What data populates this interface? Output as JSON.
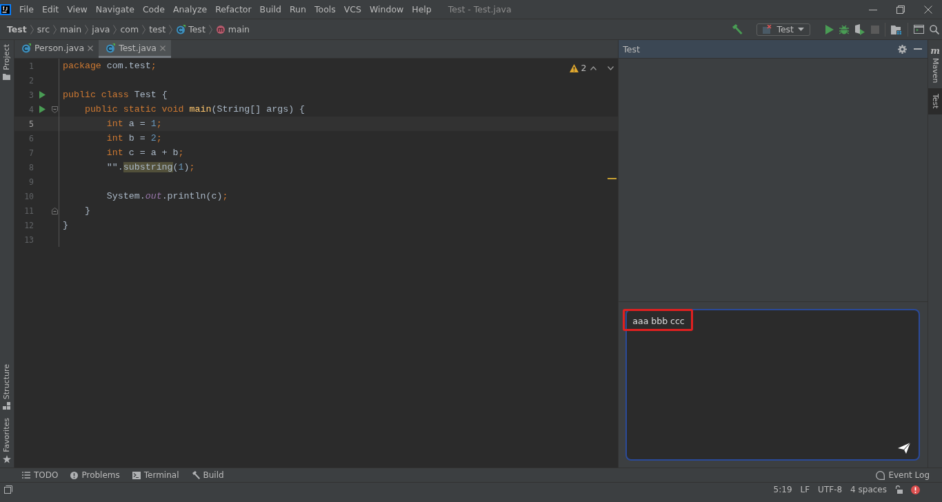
{
  "window": {
    "title": "Test - Test.java"
  },
  "menu": [
    "File",
    "Edit",
    "View",
    "Navigate",
    "Code",
    "Analyze",
    "Refactor",
    "Build",
    "Run",
    "Tools",
    "VCS",
    "Window",
    "Help"
  ],
  "breadcrumbs": [
    {
      "label": "Test",
      "kind": "project"
    },
    {
      "label": "src",
      "kind": "folder"
    },
    {
      "label": "main",
      "kind": "folder"
    },
    {
      "label": "java",
      "kind": "folder"
    },
    {
      "label": "com",
      "kind": "folder"
    },
    {
      "label": "test",
      "kind": "folder"
    },
    {
      "label": "Test",
      "kind": "class"
    },
    {
      "label": "main",
      "kind": "method"
    }
  ],
  "run_config": {
    "label": "Test"
  },
  "editor_tabs": [
    {
      "label": "Person.java",
      "selected": false
    },
    {
      "label": "Test.java",
      "selected": true
    }
  ],
  "left_stripes_top": [
    {
      "label": "Project",
      "kind": "project"
    }
  ],
  "left_stripes_bottom": [
    {
      "label": "Structure",
      "kind": "structure"
    },
    {
      "label": "Favorites",
      "kind": "favorites"
    }
  ],
  "right_stripes": [
    {
      "label": "Maven",
      "kind": "maven",
      "glyph": "m",
      "selected": false
    },
    {
      "label": "Test",
      "kind": "plain",
      "selected": true
    }
  ],
  "editor": {
    "warnings": "2",
    "lines": [
      {
        "number": "1",
        "current": false,
        "run": false,
        "fold_start": false,
        "fold_end": false,
        "tokens": [
          {
            "text": "package",
            "kind": "keyword"
          },
          {
            "text": " com.test",
            "kind": "plain"
          },
          {
            "text": ";",
            "kind": "punct"
          }
        ]
      },
      {
        "number": "2",
        "current": false,
        "run": false,
        "fold_start": false,
        "fold_end": false
      },
      {
        "number": "3",
        "current": false,
        "run": true,
        "fold_start": false,
        "fold_end": false,
        "tokens": [
          {
            "text": "public class",
            "kind": "keyword"
          },
          {
            "text": " Test {",
            "kind": "plain"
          }
        ]
      },
      {
        "number": "4",
        "current": false,
        "run": true,
        "fold_start": true,
        "fold_end": false,
        "tokens": [
          {
            "text": "    public static void ",
            "kind": "keyword"
          },
          {
            "text": "main",
            "kind": "method"
          },
          {
            "text": "(String[] args) {",
            "kind": "plain"
          }
        ]
      },
      {
        "number": "5",
        "current": true,
        "run": false,
        "fold_start": false,
        "fold_end": false,
        "tokens": [
          {
            "text": "        int",
            "kind": "keyword"
          },
          {
            "text": " a = ",
            "kind": "plain"
          },
          {
            "text": "1",
            "kind": "number"
          },
          {
            "text": ";",
            "kind": "punct"
          }
        ]
      },
      {
        "number": "6",
        "current": false,
        "run": false,
        "fold_start": false,
        "fold_end": false,
        "tokens": [
          {
            "text": "        int",
            "kind": "keyword"
          },
          {
            "text": " b = ",
            "kind": "plain"
          },
          {
            "text": "2",
            "kind": "number"
          },
          {
            "text": ";",
            "kind": "punct"
          }
        ]
      },
      {
        "number": "7",
        "current": false,
        "run": false,
        "fold_start": false,
        "fold_end": false,
        "tokens": [
          {
            "text": "        int",
            "kind": "keyword"
          },
          {
            "text": " c = a + b",
            "kind": "plain"
          },
          {
            "text": ";",
            "kind": "punct"
          }
        ]
      },
      {
        "number": "8",
        "current": false,
        "run": false,
        "fold_start": false,
        "fold_end": false,
        "tokens": [
          {
            "text": "        \"\".",
            "kind": "plain"
          },
          {
            "text": "substring",
            "kind": "match"
          },
          {
            "text": "(",
            "kind": "plain"
          },
          {
            "text": "1",
            "kind": "number"
          },
          {
            "text": ")",
            "kind": "plain"
          },
          {
            "text": ";",
            "kind": "punct"
          }
        ]
      },
      {
        "number": "9",
        "current": false,
        "run": false,
        "fold_start": false,
        "fold_end": false
      },
      {
        "number": "10",
        "current": false,
        "run": false,
        "fold_start": false,
        "fold_end": false,
        "tokens": [
          {
            "text": "        System.",
            "kind": "plain"
          },
          {
            "text": "out",
            "kind": "field"
          },
          {
            "text": ".println(c)",
            "kind": "plain"
          },
          {
            "text": ";",
            "kind": "punct"
          }
        ]
      },
      {
        "number": "11",
        "current": false,
        "run": false,
        "fold_start": false,
        "fold_end": true,
        "tokens": [
          {
            "text": "    }",
            "kind": "plain"
          }
        ]
      },
      {
        "number": "12",
        "current": false,
        "run": false,
        "fold_start": false,
        "fold_end": false,
        "tokens": [
          {
            "text": "}",
            "kind": "plain"
          }
        ]
      },
      {
        "number": "13",
        "current": false,
        "run": false,
        "fold_start": false,
        "fold_end": false
      }
    ]
  },
  "tool_window": {
    "title": "Test",
    "input": {
      "value": "aaa bbb ccc"
    }
  },
  "bottom_tools": [
    {
      "label": "TODO",
      "kind": "todo"
    },
    {
      "label": "Problems",
      "kind": "problems"
    },
    {
      "label": "Terminal",
      "kind": "terminal"
    },
    {
      "label": "Build",
      "kind": "build"
    }
  ],
  "event_log": "Event Log",
  "status_bar": {
    "position": "5:19",
    "line_separator": "LF",
    "encoding": "UTF-8",
    "indent": "4 spaces"
  }
}
